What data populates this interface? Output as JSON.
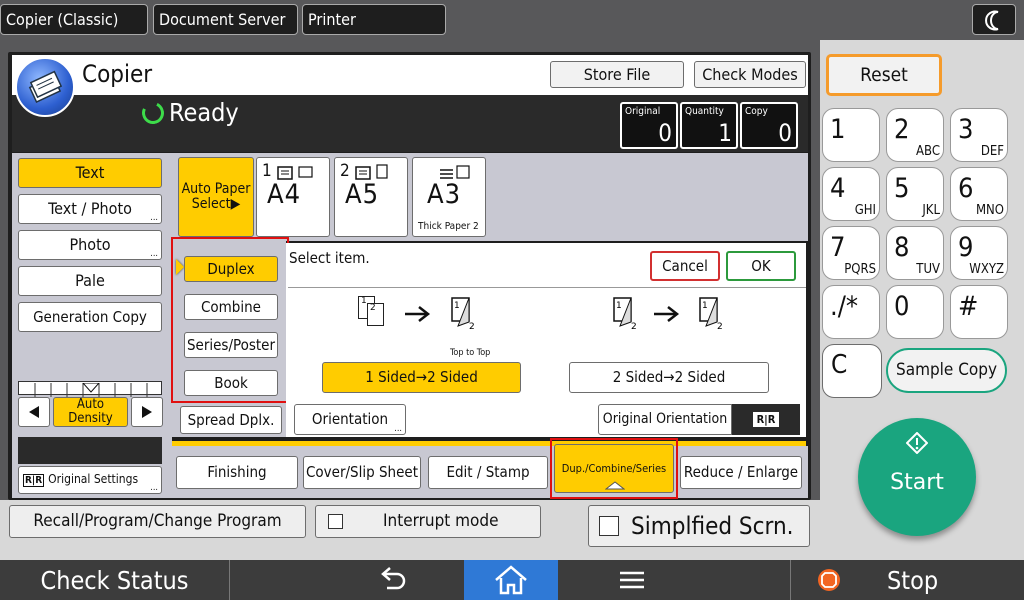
{
  "topbar": {
    "tabs": [
      "Copier (Classic)",
      "Document Server",
      "Printer"
    ],
    "moon_icon": "moon-icon"
  },
  "header": {
    "app_title": "Copier",
    "status": "Ready",
    "store_file": "Store File",
    "check_modes": "Check Modes"
  },
  "counters": {
    "original_label": "Original",
    "original_value": "0",
    "quantity_label": "Quantity",
    "quantity_value": "1",
    "copy_label": "Copy",
    "copy_value": "0"
  },
  "image_types": [
    "Text",
    "Text / Photo",
    "Photo",
    "Pale",
    "Generation Copy"
  ],
  "density": {
    "label": "Auto Density",
    "level_fraction": 0.5
  },
  "original_settings": "Original Settings",
  "paper": {
    "auto_line1": "Auto Paper",
    "auto_line2": "Select▶",
    "trays": [
      {
        "num": "1",
        "size": "A4",
        "note": ""
      },
      {
        "num": "2",
        "size": "A5",
        "note": ""
      },
      {
        "num": "",
        "size": "A3",
        "note": "Thick Paper 2"
      }
    ]
  },
  "modes": [
    "Duplex",
    "Combine",
    "Series/Poster",
    "Book",
    "Spread Dplx."
  ],
  "dialog": {
    "prompt": "Select item.",
    "cancel": "Cancel",
    "ok": "OK",
    "opt1": "1 Sided→2 Sided",
    "opt1_note": "Top to Top",
    "opt2": "2 Sided→2 Sided",
    "orientation": "Orientation",
    "original_orientation": "Original Orientation"
  },
  "func_tabs": [
    "Finishing",
    "Cover/Slip Sheet",
    "Edit / Stamp",
    "Dup./Combine/Series",
    "Reduce / Enlarge"
  ],
  "footer_row": {
    "recall": "Recall/Program/Change Program",
    "interrupt": "Interrupt mode",
    "simplified": "Simplfied Scrn."
  },
  "keypad": {
    "reset": "Reset",
    "keys": [
      {
        "d": "1",
        "s": ""
      },
      {
        "d": "2",
        "s": "ABC"
      },
      {
        "d": "3",
        "s": "DEF"
      },
      {
        "d": "4",
        "s": "GHI"
      },
      {
        "d": "5",
        "s": "JKL"
      },
      {
        "d": "6",
        "s": "MNO"
      },
      {
        "d": "7",
        "s": "PQRS"
      },
      {
        "d": "8",
        "s": "TUV"
      },
      {
        "d": "9",
        "s": "WXYZ"
      },
      {
        "d": "./*",
        "s": ""
      },
      {
        "d": "0",
        "s": ""
      },
      {
        "d": "#",
        "s": ""
      }
    ],
    "clear": "C",
    "sample_copy": "Sample Copy",
    "start": "Start"
  },
  "bottombar": {
    "check_status": "Check Status",
    "stop": "Stop"
  },
  "colors": {
    "accent_yellow": "#ffcc00",
    "start_green": "#1aa57f",
    "highlight_red": "#e01010"
  }
}
